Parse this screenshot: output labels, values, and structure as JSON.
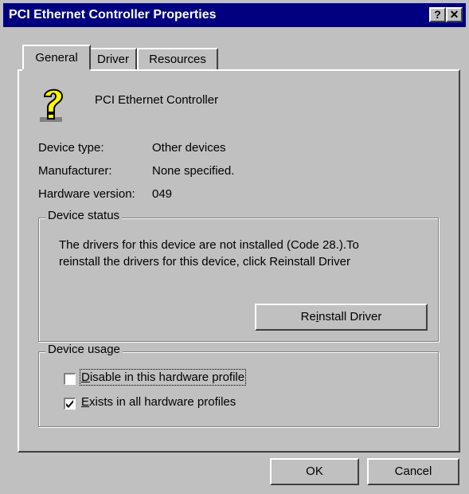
{
  "window": {
    "title": "PCI Ethernet Controller Properties",
    "help_glyph": "?",
    "close_glyph": "✕"
  },
  "tabs": [
    {
      "label": "General"
    },
    {
      "label": "Driver"
    },
    {
      "label": "Resources"
    }
  ],
  "device": {
    "icon": "question-mark-device-icon",
    "name": "PCI Ethernet Controller",
    "type_label": "Device type:",
    "type_value": "Other devices",
    "manufacturer_label": "Manufacturer:",
    "manufacturer_value": "None specified.",
    "hardware_version_label": "Hardware version:",
    "hardware_version_value": "049"
  },
  "status": {
    "legend": "Device status",
    "line1": "The drivers for this device are not installed  (Code 28.).To",
    "line2": "reinstall the drivers for this device, click Reinstall Driver",
    "reinstall_pre": "Re",
    "reinstall_key": "i",
    "reinstall_post": "nstall Driver"
  },
  "usage": {
    "legend": "Device usage",
    "disable_key": "D",
    "disable_rest": "isable in this hardware profile",
    "disable_checked": false,
    "exists_key": "E",
    "exists_rest": "xists in all hardware profiles",
    "exists_checked": true
  },
  "buttons": {
    "ok": "OK",
    "cancel": "Cancel"
  },
  "colors": {
    "titlebar": "#000080",
    "face": "#c0c0c0"
  }
}
